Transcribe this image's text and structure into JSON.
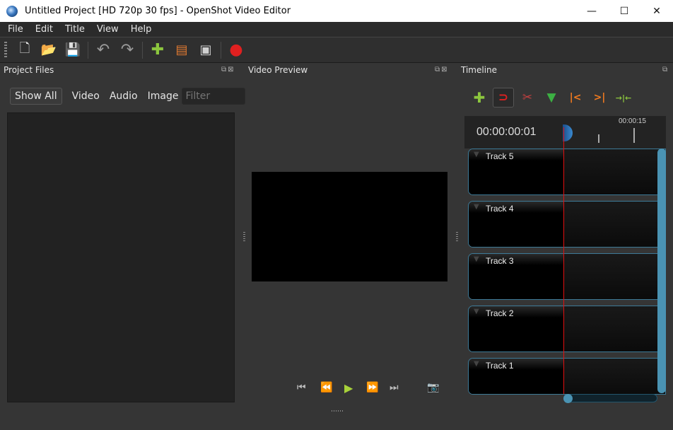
{
  "window": {
    "title": "Untitled Project [HD 720p 30 fps] - OpenShot Video Editor",
    "controls": {
      "minimize": "—",
      "maximize": "☐",
      "close": "✕"
    }
  },
  "menu": [
    "File",
    "Edit",
    "Title",
    "View",
    "Help"
  ],
  "toolbar": [
    {
      "name": "new-project",
      "icon": "🗋",
      "color": "#e8e8e8"
    },
    {
      "name": "open-project",
      "icon": "📂",
      "color": "#e07a30"
    },
    {
      "name": "save-project",
      "icon": "💾",
      "color": "#888888"
    },
    {
      "name": "undo",
      "icon": "↶",
      "color": "#9a9a9a"
    },
    {
      "name": "redo",
      "icon": "↷",
      "color": "#9a9a9a"
    },
    {
      "name": "import-files",
      "icon": "✚",
      "color": "#8cc63e"
    },
    {
      "name": "choose-profile",
      "icon": "▤",
      "color": "#e07a30"
    },
    {
      "name": "fullscreen",
      "icon": "▣",
      "color": "#d0d0d0"
    },
    {
      "name": "export-video",
      "icon": "●",
      "color": "#e02020"
    }
  ],
  "project_files": {
    "title": "Project Files",
    "filters": [
      "Show All",
      "Video",
      "Audio",
      "Image"
    ],
    "filter_placeholder": "Filter",
    "dock_buttons": "⧉⊠"
  },
  "video_preview": {
    "title": "Video Preview",
    "dock_buttons": "⧉⊠",
    "controls": [
      {
        "name": "jump-start",
        "icon": "⏮"
      },
      {
        "name": "rewind",
        "icon": "⏪"
      },
      {
        "name": "play",
        "icon": "▶"
      },
      {
        "name": "fast-forward",
        "icon": "⏩"
      },
      {
        "name": "jump-end",
        "icon": "⏭"
      }
    ],
    "snapshot_icon": "📷"
  },
  "timeline": {
    "title": "Timeline",
    "dock_buttons": "⧉",
    "tools": [
      {
        "name": "add-track",
        "icon": "✚",
        "color": "#8cc63e"
      },
      {
        "name": "snapping",
        "icon": "⊃",
        "color": "#e02020",
        "active": true
      },
      {
        "name": "razor",
        "icon": "✂",
        "color": "#c44040"
      },
      {
        "name": "add-marker",
        "icon": "▼",
        "color": "#3cb043"
      },
      {
        "name": "previous-marker",
        "icon": "|<",
        "color": "#f07a20"
      },
      {
        "name": "next-marker",
        "icon": ">|",
        "color": "#f07a20"
      },
      {
        "name": "center-playhead",
        "icon": "→|←",
        "color": "#8cc63e"
      }
    ],
    "timecode": "00:00:00:01",
    "ruler_label": "00:00:15",
    "tracks": [
      "Track 5",
      "Track 4",
      "Track 3",
      "Track 2",
      "Track 1"
    ]
  }
}
